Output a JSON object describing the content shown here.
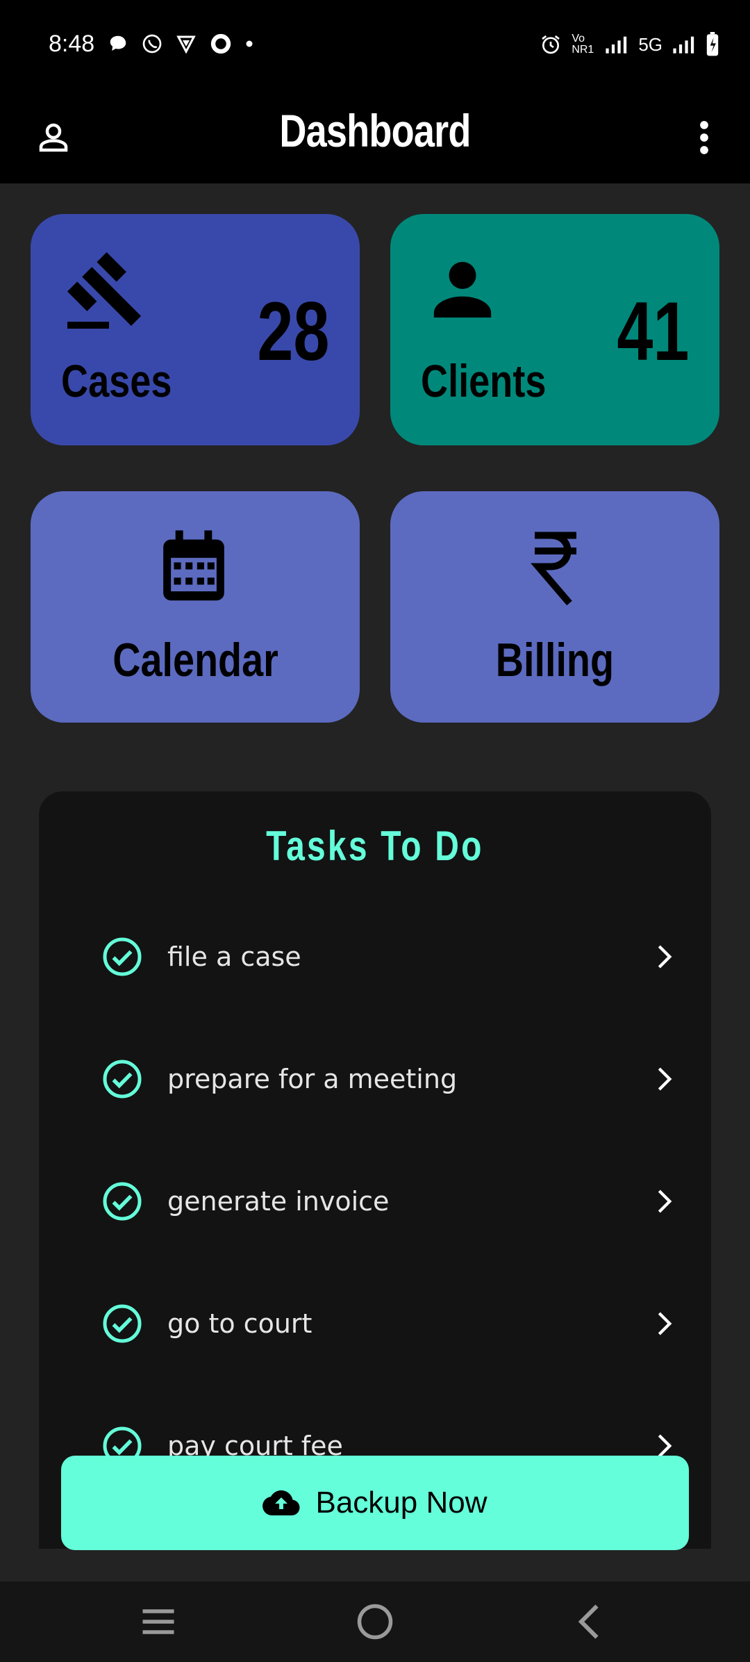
{
  "status_bar": {
    "time": "8:48",
    "network": "5G",
    "volte": "Vo NR1"
  },
  "app_bar": {
    "title": "Dashboard",
    "profile_icon": "person-outline-icon",
    "menu_icon": "more-vert-icon"
  },
  "tiles": {
    "cases": {
      "label": "Cases",
      "count": "28",
      "icon": "gavel-icon",
      "color": "#3949ab"
    },
    "clients": {
      "label": "Clients",
      "count": "41",
      "icon": "person-icon",
      "color": "#00897b"
    },
    "calendar": {
      "label": "Calendar",
      "icon": "calendar-icon",
      "color": "#5c6bc0"
    },
    "billing": {
      "label": "Billing",
      "icon": "rupee-icon",
      "symbol": "₹",
      "color": "#5c6bc0"
    }
  },
  "tasks": {
    "title": "Tasks To Do",
    "items": [
      {
        "label": "file a case"
      },
      {
        "label": "prepare for a meeting"
      },
      {
        "label": "generate invoice"
      },
      {
        "label": "go to court"
      },
      {
        "label": "pay court fee"
      }
    ]
  },
  "backup": {
    "label": "Backup Now",
    "icon": "cloud-upload-icon",
    "color": "#64ffda"
  },
  "nav_bar": {
    "items": [
      "recents-icon",
      "home-icon",
      "back-icon"
    ]
  }
}
